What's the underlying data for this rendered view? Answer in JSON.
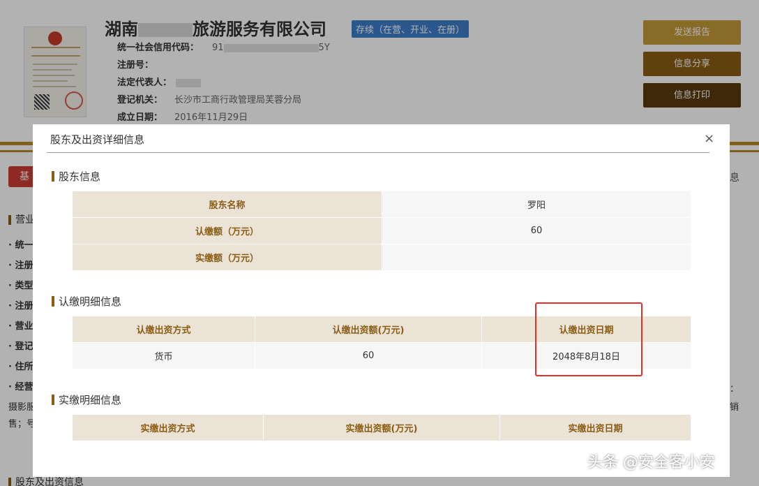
{
  "company": {
    "name_prefix": "湖南",
    "name_suffix": "旅游服务有限公司",
    "status": "存续（在营、开业、在册）"
  },
  "info": {
    "credit_code_label": "统一社会信用代码：",
    "credit_code_start": "91",
    "credit_code_end": "5Y",
    "reg_no_label": "注册号：",
    "legal_rep_label": "法定代表人：",
    "authority_label": "登记机关：",
    "authority_value": "长沙市工商行政管理局芙蓉分局",
    "est_date_label": "成立日期：",
    "est_date_value": "2016年11月29日"
  },
  "side_buttons": {
    "send": "发送报告",
    "share": "信息分享",
    "print": "信息打印"
  },
  "background": {
    "tab_base": "基",
    "right_tab": "息",
    "section_label": "营业",
    "list_items": [
      "· 统一",
      "· 注册",
      "· 类型",
      "· 注册",
      "· 营业",
      "· 登记",
      "· 住所",
      "· 经营"
    ],
    "extra_line1": "摄影服",
    "extra_line2": "售；号",
    "right_frag1": "：",
    "right_frag2": "销",
    "bottom_section": "股东及出资信息"
  },
  "modal": {
    "title": "股东及出资详细信息",
    "close": "×",
    "shareholder": {
      "heading": "股东信息",
      "rows": [
        {
          "key": "股东名称",
          "value": "罗阳"
        },
        {
          "key": "认缴额（万元）",
          "value": "60"
        },
        {
          "key": "实缴额（万元）",
          "value": ""
        }
      ]
    },
    "subscription": {
      "heading": "认缴明细信息",
      "headers": [
        "认缴出资方式",
        "认缴出资额(万元)",
        "认缴出资日期"
      ],
      "row": [
        "货币",
        "60",
        "2048年8月18日"
      ]
    },
    "paid": {
      "heading": "实缴明细信息",
      "headers": [
        "实缴出资方式",
        "实缴出资额(万元)",
        "实缴出资日期"
      ]
    }
  },
  "watermark": "头条 @安全客小安",
  "colors": {
    "brand_brown": "#8a5c14",
    "gold": "#c49a3a",
    "header_bg": "#ebe3d5",
    "status_blue": "#3d7ec9",
    "highlight_red": "#e53028"
  }
}
